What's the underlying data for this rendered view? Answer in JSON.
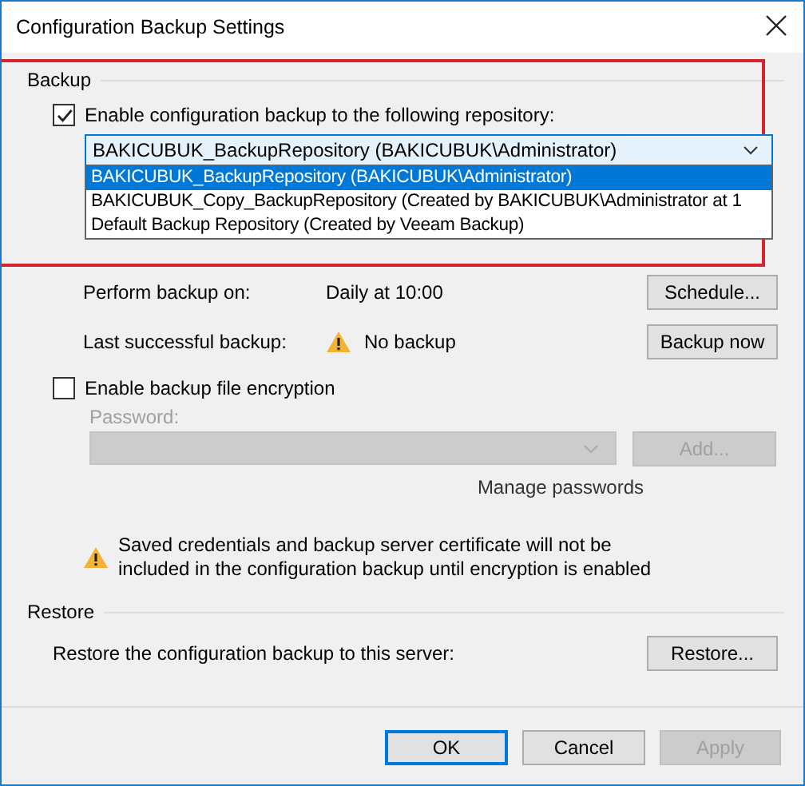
{
  "window": {
    "title": "Configuration Backup Settings"
  },
  "highlight_backup": true,
  "backup": {
    "title": "Backup",
    "enable": {
      "label": "Enable configuration backup to the following repository:",
      "checked": true
    },
    "repository": {
      "value": "BAKICUBUK_BackupRepository (BAKICUBUK\\Administrator)",
      "expanded": true,
      "options": [
        {
          "label": "BAKICUBUK_BackupRepository (BAKICUBUK\\Administrator)",
          "selected": true
        },
        {
          "label": "BAKICUBUK_Copy_BackupRepository (Created by BAKICUBUK\\Administrator at 1",
          "selected": false
        },
        {
          "label": "Default Backup Repository (Created by Veeam Backup)",
          "selected": false
        }
      ]
    },
    "schedule": {
      "label": "Perform backup on:",
      "value": "Daily at 10:00",
      "button": "Schedule..."
    },
    "last": {
      "label": "Last successful backup:",
      "value": "No backup",
      "button": "Backup now"
    },
    "encryption": {
      "label": "Enable backup file encryption",
      "checked": false
    },
    "password": {
      "label": "Password:",
      "disabled": true
    },
    "add_button": {
      "label": "Add...",
      "disabled": true
    },
    "manage_link": "Manage passwords",
    "warning": "Saved credentials and backup server certificate will not be included in the configuration backup until encryption is enabled"
  },
  "restore": {
    "title": "Restore",
    "label": "Restore the configuration backup to this server:",
    "button": "Restore..."
  },
  "buttons": [
    {
      "label": "OK",
      "kind": "default",
      "disabled": false
    },
    {
      "label": "Cancel",
      "kind": "normal",
      "disabled": false
    },
    {
      "label": "Apply",
      "kind": "normal",
      "disabled": true
    }
  ]
}
